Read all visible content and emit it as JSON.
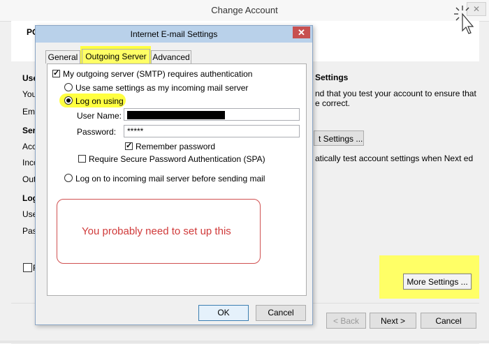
{
  "background": {
    "title": "Change Account",
    "header_label": "PO",
    "left_labels": [
      "Use",
      "You",
      "Ema",
      "Serv",
      "Acc",
      "Inco",
      "Out",
      "Log",
      "Use",
      "Pas"
    ],
    "settings_title": "Settings",
    "settings_desc": "nd that you test your account to ensure that e correct.",
    "test_button": "t Settings ...",
    "auto_desc": "atically test account settings when Next ed",
    "checkbox_label": "F",
    "more_settings": "More Settings ...",
    "back": "< Back",
    "next": "Next >",
    "cancel": "Cancel"
  },
  "dialog": {
    "title": "Internet E-mail Settings",
    "close": "✕",
    "tabs": [
      "General",
      "Outgoing Server",
      "Advanced"
    ],
    "auth_checkbox": "My outgoing server (SMTP) requires authentication",
    "use_same": "Use same settings as my incoming mail server",
    "log_on_using": "Log on using",
    "user_name_label": "User Name:",
    "password_label": "Password:",
    "password_value": "*****",
    "remember": "Remember password",
    "spa": "Require Secure Password Authentication (SPA)",
    "log_on_incoming": "Log on to incoming mail server before sending mail",
    "ok": "OK",
    "cancel": "Cancel"
  },
  "callout": "You probably need to set up this",
  "colors": {
    "highlight": "#ffff66",
    "callout_red": "#d03a3a",
    "dialog_title_bar": "#b9d1ea"
  },
  "icons": [
    "close-icon",
    "cursor-click-icon"
  ]
}
